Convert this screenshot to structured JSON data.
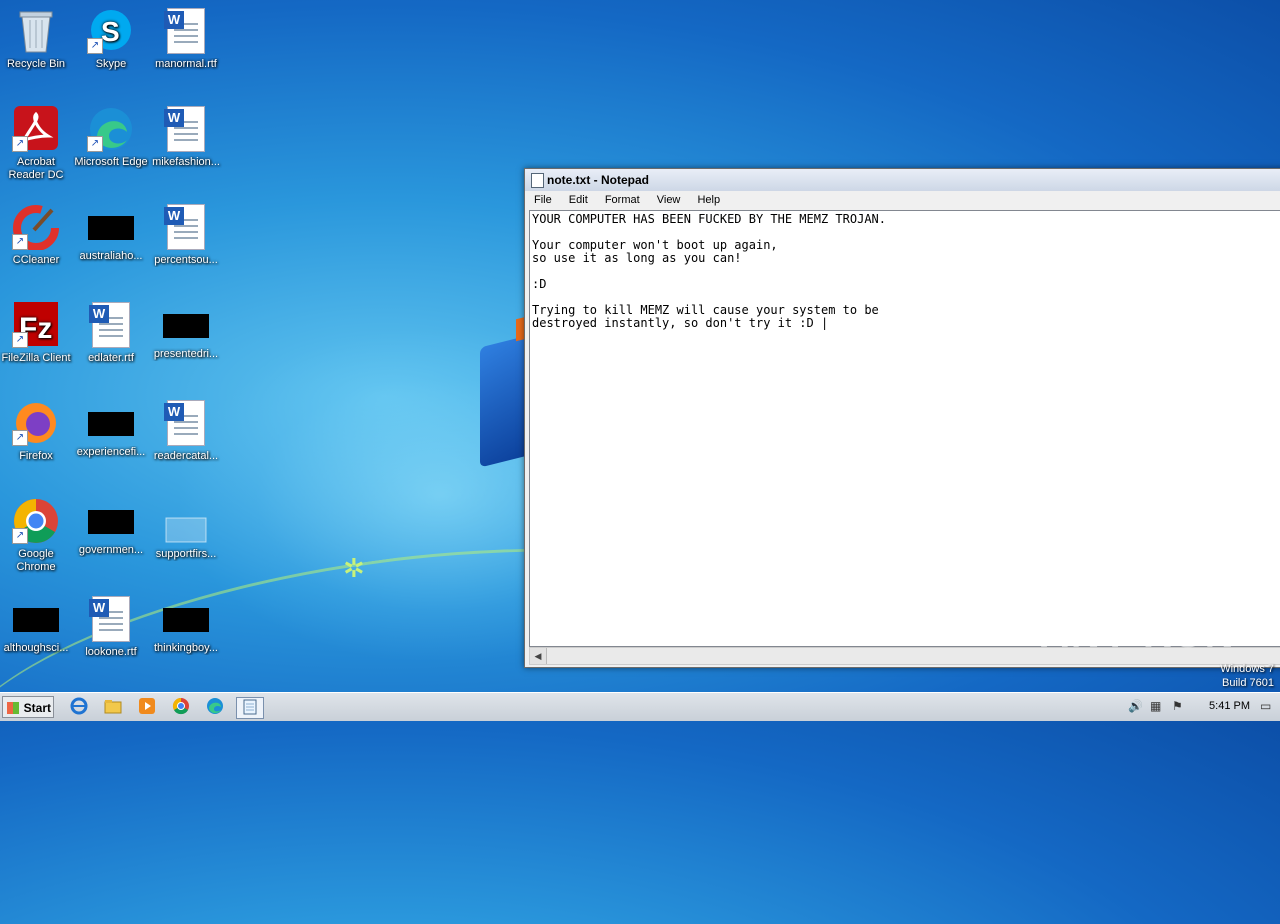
{
  "desktop": {
    "icons": [
      {
        "label": "Recycle Bin",
        "icon": "recycle-bin-icon"
      },
      {
        "label": "Skype",
        "icon": "skype-icon"
      },
      {
        "label": "manormal.rtf",
        "icon": "word-doc-icon"
      },
      {
        "label": "Acrobat Reader DC",
        "icon": "acrobat-icon"
      },
      {
        "label": "Microsoft Edge",
        "icon": "edge-icon"
      },
      {
        "label": "mikefashion...",
        "icon": "word-doc-icon"
      },
      {
        "label": "CCleaner",
        "icon": "ccleaner-icon"
      },
      {
        "label": "australiaho...",
        "icon": "black-file-icon"
      },
      {
        "label": "percentsou...",
        "icon": "word-doc-icon"
      },
      {
        "label": "FileZilla Client",
        "icon": "filezilla-icon"
      },
      {
        "label": "edlater.rtf",
        "icon": "word-doc-icon"
      },
      {
        "label": "presentedri...",
        "icon": "black-file-icon"
      },
      {
        "label": "Firefox",
        "icon": "firefox-icon"
      },
      {
        "label": "experiencefi...",
        "icon": "black-file-icon"
      },
      {
        "label": "readercatal...",
        "icon": "word-doc-icon"
      },
      {
        "label": "Google Chrome",
        "icon": "chrome-icon"
      },
      {
        "label": "governmen...",
        "icon": "black-file-icon"
      },
      {
        "label": "supportfirs...",
        "icon": "blank-file-icon"
      },
      {
        "label": "althoughsci...",
        "icon": "black-file-icon"
      },
      {
        "label": "lookone.rtf",
        "icon": "word-doc-icon"
      },
      {
        "label": "thinkingboy...",
        "icon": "black-file-icon"
      }
    ]
  },
  "notepad": {
    "title": "note.txt - Notepad",
    "menu": [
      "File",
      "Edit",
      "Format",
      "View",
      "Help"
    ],
    "content": "YOUR COMPUTER HAS BEEN FUCKED BY THE MEMZ TROJAN.\n\nYour computer won't boot up again,\nso use it as long as you can!\n\n:D\n\nTrying to kill MEMZ will cause your system to be\ndestroyed instantly, so don't try it :D |"
  },
  "watermark": "ANY RUN",
  "windows_text": {
    "line1": "Windows 7",
    "line2": "Build 7601"
  },
  "taskbar": {
    "start_label": "Start",
    "pinned": [
      "internet-explorer-icon",
      "file-explorer-icon",
      "media-player-icon",
      "chrome-icon",
      "edge-icon",
      "notepad-icon"
    ],
    "clock": "5:41 PM"
  }
}
